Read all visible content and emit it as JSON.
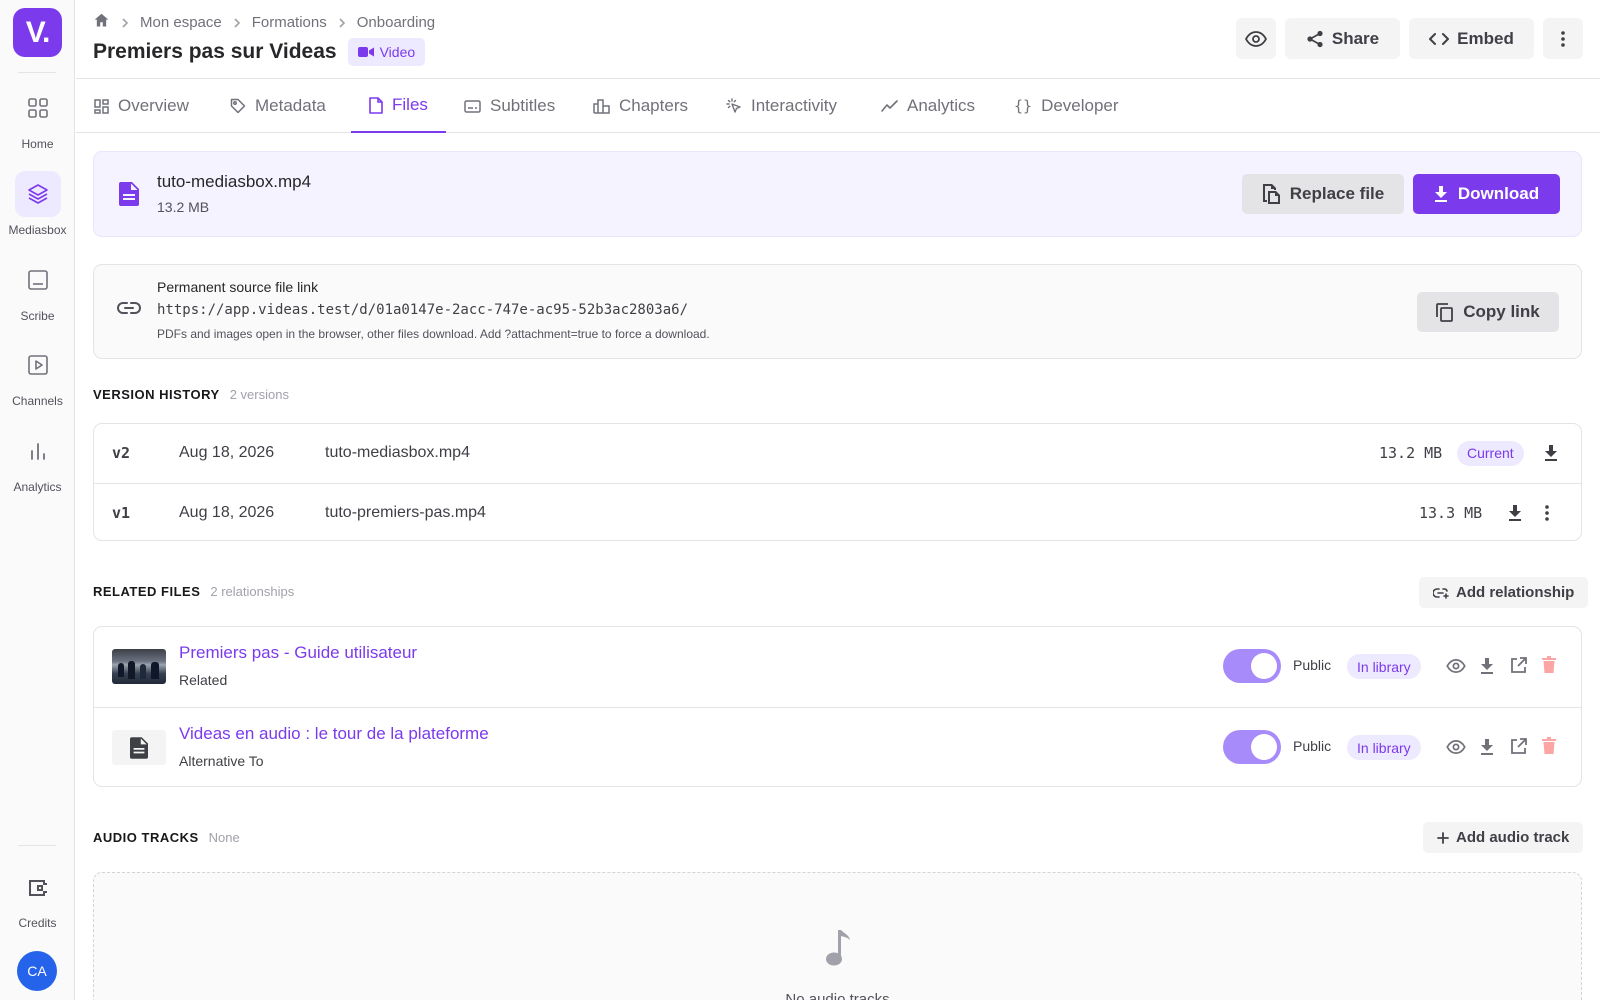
{
  "brand": {
    "logo_text": "V.",
    "accent": "#7c3aed"
  },
  "sidebar": {
    "items": [
      {
        "label": "Home",
        "icon": "grid-icon"
      },
      {
        "label": "Mediasbox",
        "icon": "layers-icon"
      },
      {
        "label": "Scribe",
        "icon": "document-icon"
      },
      {
        "label": "Channels",
        "icon": "play-icon"
      },
      {
        "label": "Analytics",
        "icon": "bar-chart-icon"
      }
    ],
    "credits_label": "Credits",
    "avatar_initials": "CA"
  },
  "breadcrumb": [
    "Mon espace",
    "Formations",
    "Onboarding"
  ],
  "header": {
    "title": "Premiers pas sur Videas",
    "type_badge": "Video",
    "share_label": "Share",
    "embed_label": "Embed"
  },
  "tabs": [
    {
      "label": "Overview",
      "icon": "dashboard-icon"
    },
    {
      "label": "Metadata",
      "icon": "tag-icon"
    },
    {
      "label": "Files",
      "icon": "file-icon",
      "active": true
    },
    {
      "label": "Subtitles",
      "icon": "subtitles-icon"
    },
    {
      "label": "Chapters",
      "icon": "chapters-icon"
    },
    {
      "label": "Interactivity",
      "icon": "click-icon"
    },
    {
      "label": "Analytics",
      "icon": "trend-icon"
    },
    {
      "label": "Developer",
      "icon": "braces-icon"
    }
  ],
  "file": {
    "name": "tuto-mediasbox.mp4",
    "size": "13.2 MB",
    "replace_label": "Replace file",
    "download_label": "Download"
  },
  "source_link": {
    "title": "Permanent source file link",
    "url": "https://app.videas.test/d/01a0147e-2acc-747e-ac95-52b3ac2803a6/",
    "note": "PDFs and images open in the browser, other files download. Add ?attachment=true to force a download.",
    "copy_label": "Copy link"
  },
  "version_history": {
    "heading": "VERSION HISTORY",
    "count": "2 versions",
    "rows": [
      {
        "version": "v2",
        "date": "Aug 18, 2026",
        "filename": "tuto-mediasbox.mp4",
        "size": "13.2 MB",
        "badge": "Current"
      },
      {
        "version": "v1",
        "date": "Aug 18, 2026",
        "filename": "tuto-premiers-pas.mp4",
        "size": "13.3 MB"
      }
    ]
  },
  "related_files": {
    "heading": "RELATED FILES",
    "count": "2 relationships",
    "add_label": "Add relationship",
    "rows": [
      {
        "title": "Premiers pas - Guide utilisateur",
        "relation": "Related",
        "visibility": "Public",
        "status": "In library",
        "thumb": "photo"
      },
      {
        "title": "Videas en audio : le tour de la plateforme",
        "relation": "Alternative To",
        "visibility": "Public",
        "status": "In library",
        "thumb": "document-icon"
      }
    ]
  },
  "audio_tracks": {
    "heading": "AUDIO TRACKS",
    "count": "None",
    "add_label": "Add audio track",
    "empty_text": "No audio tracks"
  }
}
